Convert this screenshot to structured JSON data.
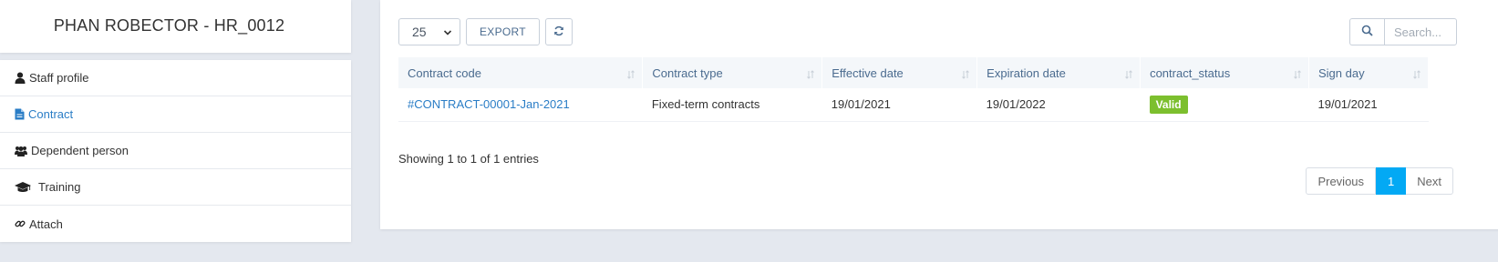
{
  "profile": {
    "title": "PHAN ROBECTOR - HR_0012"
  },
  "sidebar": {
    "items": [
      {
        "label": "Staff profile",
        "icon": "user-icon",
        "active": false
      },
      {
        "label": "Contract",
        "icon": "file-icon",
        "active": true
      },
      {
        "label": "Dependent person",
        "icon": "users-icon",
        "active": false
      },
      {
        "label": "Training",
        "icon": "graduation-cap-icon",
        "active": false
      },
      {
        "label": "Attach",
        "icon": "link-icon",
        "active": false
      }
    ]
  },
  "toolbar": {
    "page_size": "25",
    "export_label": "EXPORT",
    "refresh_icon": "refresh-icon"
  },
  "search": {
    "placeholder": "Search...",
    "icon": "search-icon"
  },
  "table": {
    "columns": [
      "Contract code",
      "Contract type",
      "Effective date",
      "Expiration date",
      "contract_status",
      "Sign day"
    ],
    "rows": [
      {
        "contract_code": "#CONTRACT-00001-Jan-2021",
        "contract_type": "Fixed-term contracts",
        "effective_date": "19/01/2021",
        "expiration_date": "19/01/2022",
        "status": "Valid",
        "sign_day": "19/01/2021"
      }
    ]
  },
  "info": "Showing 1 to 1 of 1 entries",
  "pagination": {
    "previous": "Previous",
    "current": "1",
    "next": "Next"
  },
  "colors": {
    "accent": "#2a7dc6",
    "status_valid": "#7cbf2e",
    "page_active": "#03a9f4"
  }
}
